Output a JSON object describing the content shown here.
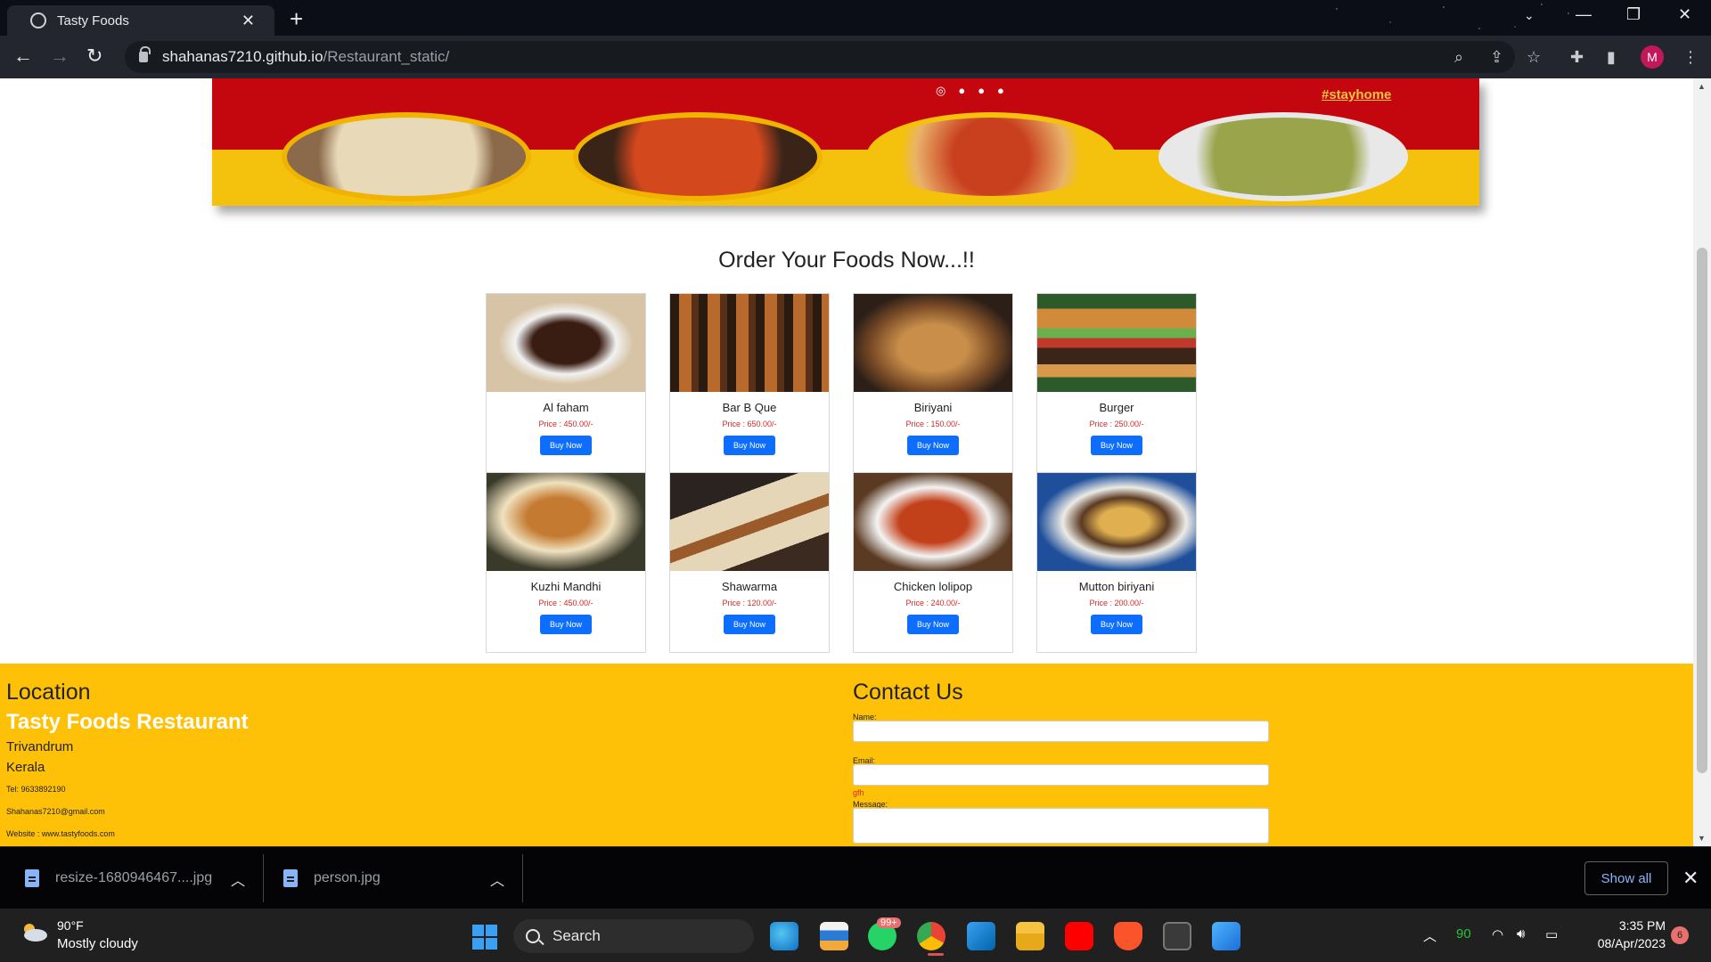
{
  "browser": {
    "tab_title": "Tasty Foods",
    "url_host": "shahanas7210.github.io",
    "url_path": "/Restaurant_static/",
    "profile_initial": "M"
  },
  "banner": {
    "hashtag": "#stayhome"
  },
  "order_title": "Order Your Foods Now...!!",
  "foods": [
    {
      "name": "Al faham",
      "price": "Price : 450.00/-",
      "button": "Buy Now"
    },
    {
      "name": "Bar B Que",
      "price": "Price : 650.00/-",
      "button": "Buy Now"
    },
    {
      "name": "Biriyani",
      "price": "Price : 150.00/-",
      "button": "Buy Now"
    },
    {
      "name": "Burger",
      "price": "Price : 250.00/-",
      "button": "Buy Now"
    },
    {
      "name": "Kuzhi Mandhi",
      "price": "Price : 450.00/-",
      "button": "Buy Now"
    },
    {
      "name": "Shawarma",
      "price": "Price : 120.00/-",
      "button": "Buy Now"
    },
    {
      "name": "Chicken lolipop",
      "price": "Price : 240.00/-",
      "button": "Buy Now"
    },
    {
      "name": "Mutton biriyani",
      "price": "Price : 200.00/-",
      "button": "Buy Now"
    }
  ],
  "footer": {
    "location_heading": "Location",
    "restaurant_name": "Tasty Foods Restaurant",
    "city": "Trivandrum",
    "state": "Kerala",
    "tel": "Tel: 9633892190",
    "email": "Shahanas7210@gmail.com",
    "website": "Website : www.tastyfoods.com",
    "contact_heading": "Contact Us",
    "name_label": "Name:",
    "email_label": "Email:",
    "email_error": "gfh",
    "message_label": "Message:"
  },
  "downloads": {
    "items": [
      "resize-1680946467....jpg",
      "person.jpg"
    ],
    "show_all": "Show all"
  },
  "taskbar": {
    "temperature": "90°F",
    "weather": "Mostly cloudy",
    "search": "Search",
    "whatsapp_badge": "99+",
    "battery_level": "90",
    "time": "3:35 PM",
    "date": "08/Apr/2023",
    "notification_count": "6"
  },
  "colors": {
    "footer_bg": "#ffc107",
    "buy_button": "#0d6efd",
    "price_text": "#d92626",
    "banner_red": "#c4070f",
    "banner_yellow": "#f4c20d"
  }
}
